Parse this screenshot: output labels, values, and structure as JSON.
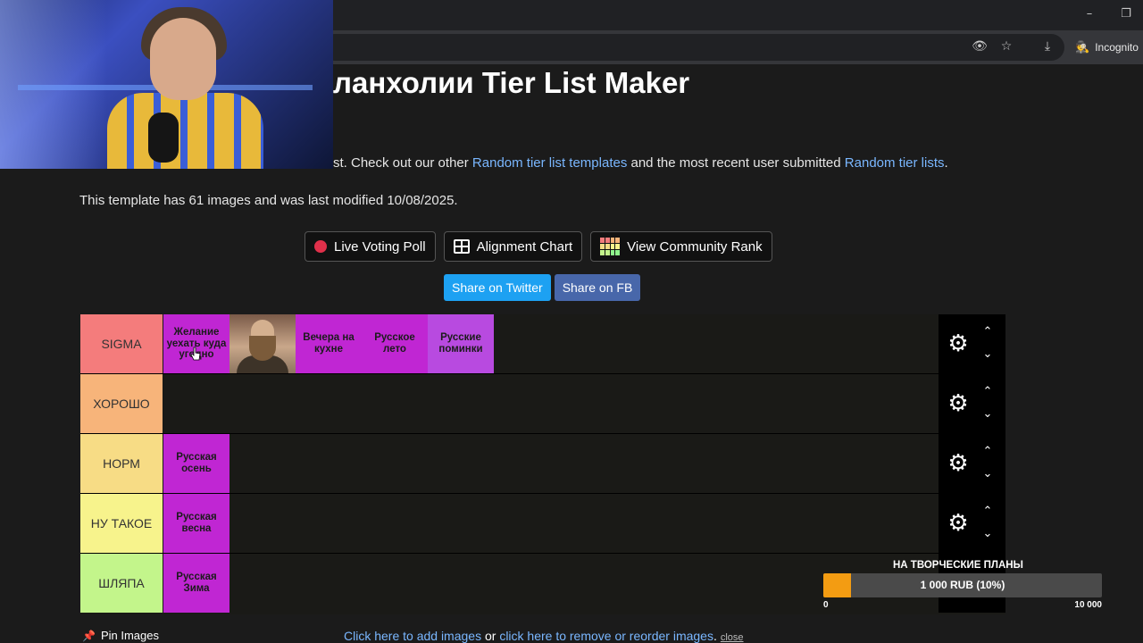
{
  "browser": {
    "minimize_glyph": "–",
    "restore_glyph": "❐",
    "icons": {
      "eye_off": "👁",
      "star": "☆",
      "download": "⤓",
      "incognito": "🕵"
    },
    "incognito_label": "Incognito"
  },
  "page": {
    "title": "ланхолии Tier List Maker",
    "intro_prefix": "st. Check out our other ",
    "intro_link1": "Random tier list templates",
    "intro_mid": " and the most recent user submitted ",
    "intro_link2": "Random tier lists",
    "intro_suffix": ".",
    "meta": "This template has 61 images and was last modified 10/08/2025."
  },
  "toolbar": {
    "live_voting": "Live Voting Poll",
    "alignment": "Alignment Chart",
    "community": "View Community Rank"
  },
  "share": {
    "twitter": "Share on Twitter",
    "fb": "Share on FB"
  },
  "tiers": [
    {
      "label": "SIGMA",
      "color": "#f47c7c"
    },
    {
      "label": "ХОРОШО",
      "color": "#f7b47a"
    },
    {
      "label": "НОРМ",
      "color": "#f7dc85"
    },
    {
      "label": "НУ ТАКОЕ",
      "color": "#f7f38c"
    },
    {
      "label": "ШЛЯПА",
      "color": "#c3f58b"
    }
  ],
  "items": {
    "sigma_1": "Желание уехать куда угодно",
    "sigma_3": "Вечера на кухне",
    "sigma_4": "Русское лето",
    "sigma_5": "Русские поминки",
    "norm_1": "Русская осень",
    "nutakoe_1": "Русская весна",
    "shlyapa_1": "Русская Зима"
  },
  "donation": {
    "title": "НА ТВОРЧЕСКИЕ ПЛАНЫ",
    "amount_text": "1 000 RUB (10%)",
    "progress": 0.1,
    "min": "0",
    "max": "10 000"
  },
  "bottom": {
    "pin_label": "Pin Images",
    "link_add": "Click here to add images",
    "or": " or ",
    "link_reorder": "click here to remove or reorder images",
    "dot": ".",
    "close": "close"
  }
}
